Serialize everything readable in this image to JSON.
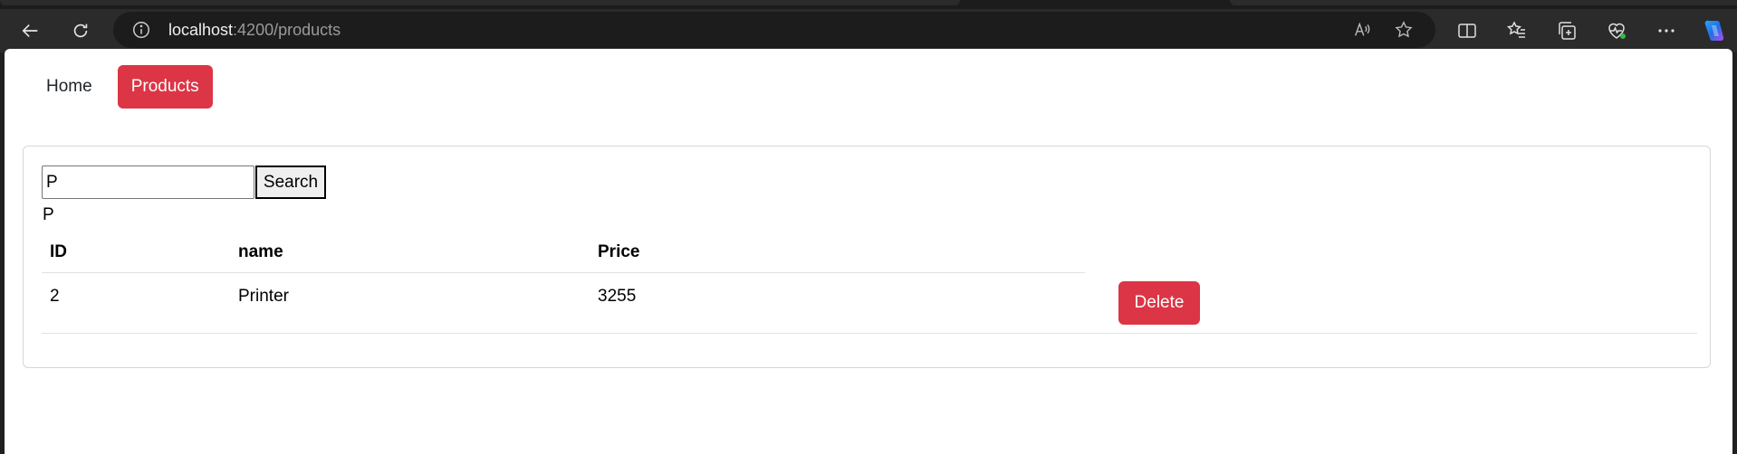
{
  "browser": {
    "url_host": "localhost",
    "url_path": ":4200/products",
    "icons": {
      "back": "back-arrow-icon",
      "refresh": "refresh-icon",
      "info": "info-icon",
      "read_aloud": "read-aloud-icon",
      "favorite": "star-icon",
      "split": "split-screen-icon",
      "favorites": "favorites-list-icon",
      "collections": "collections-icon",
      "health": "browser-essentials-icon",
      "more": "more-icon",
      "copilot": "copilot-icon"
    }
  },
  "app": {
    "nav": {
      "home": "Home",
      "products": "Products"
    },
    "search": {
      "value": "P",
      "button": "Search",
      "echo": "P"
    },
    "table": {
      "headers": {
        "id": "ID",
        "name": "name",
        "price": "Price"
      },
      "rows": [
        {
          "id": "2",
          "name": "Printer",
          "price": "3255",
          "action": "Delete"
        }
      ]
    },
    "colors": {
      "accent": "#dc3545",
      "toolbar": "#2b2b2b",
      "address_bar": "#1c1c1c"
    }
  }
}
